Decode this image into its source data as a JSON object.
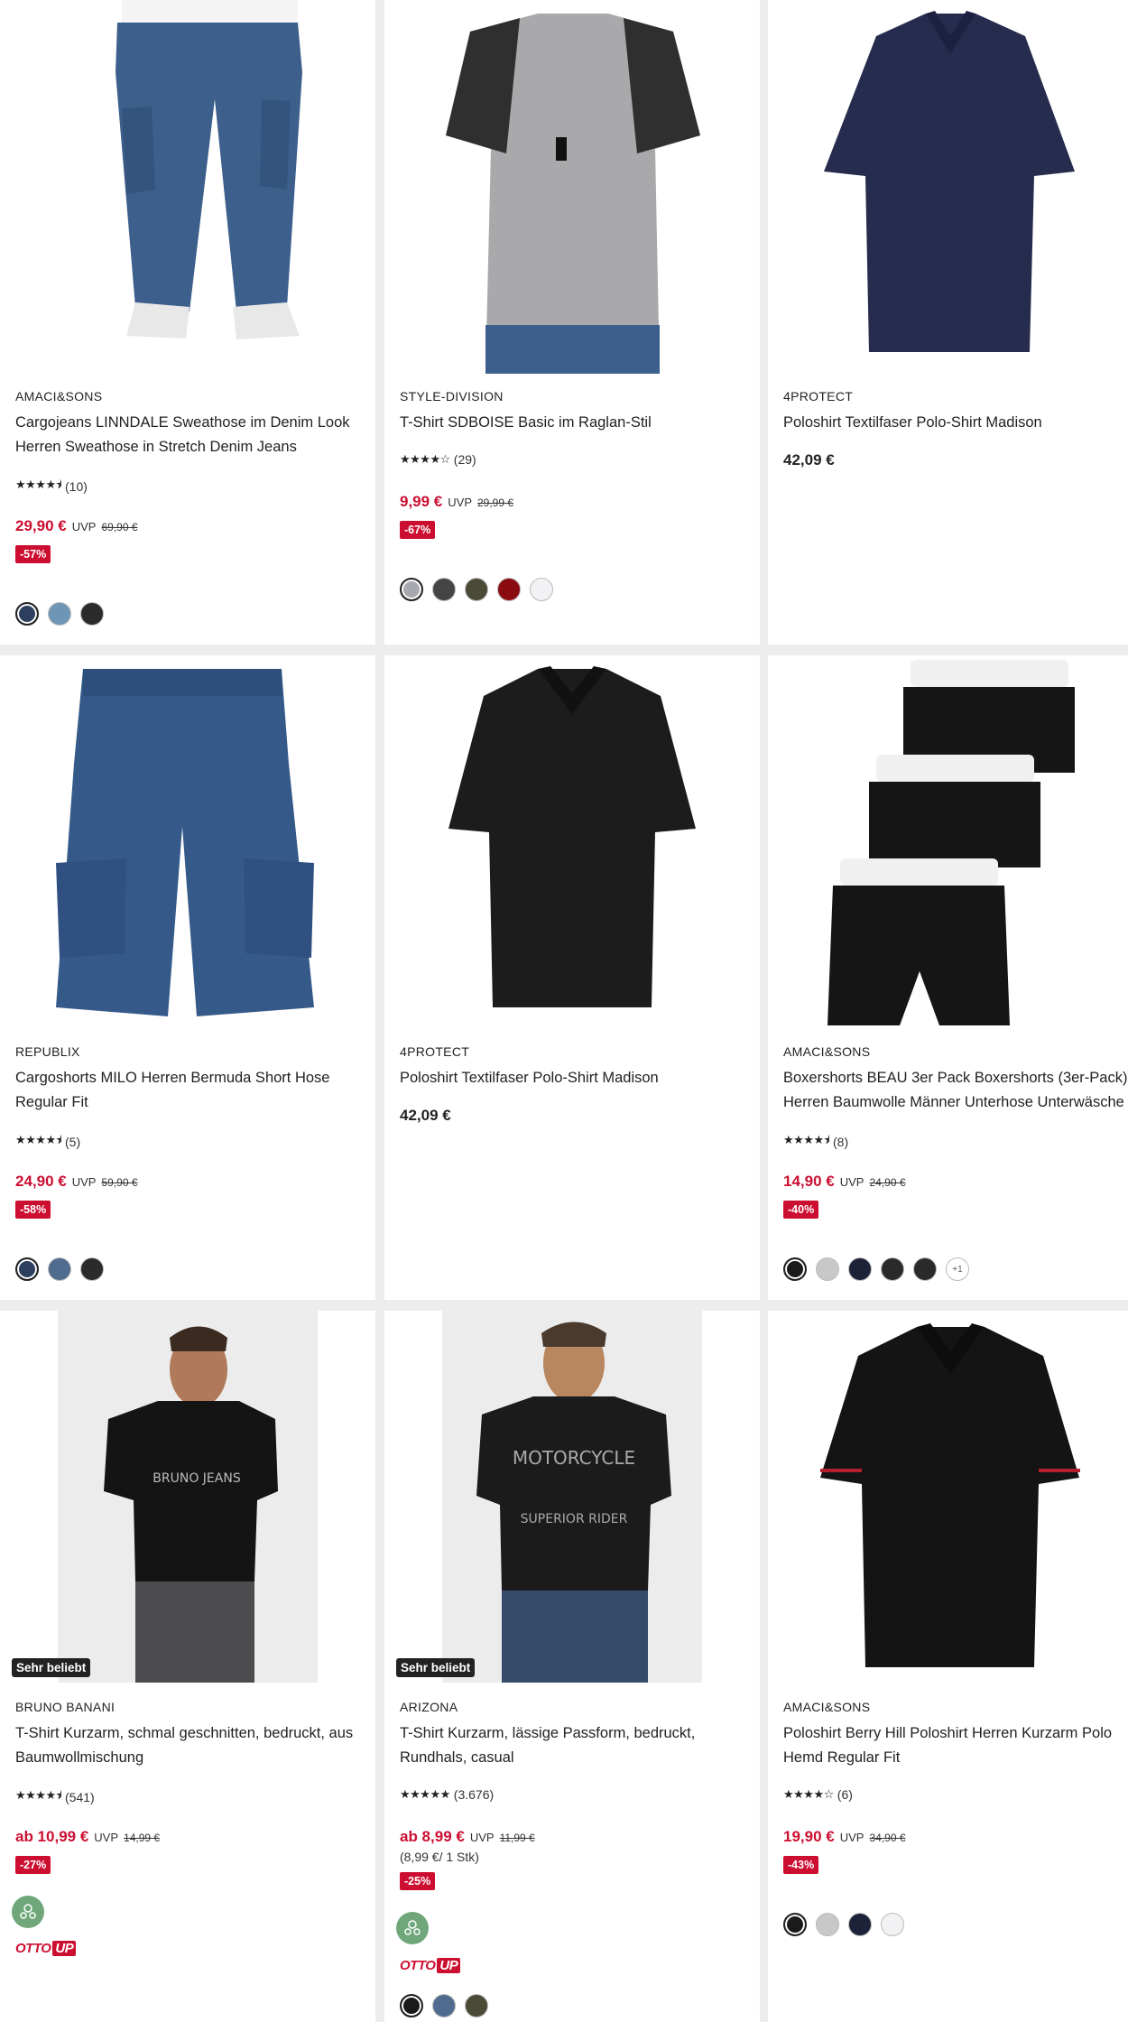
{
  "products": [
    {
      "brand": "AMACI&SONS",
      "title": "Cargojeans LINNDALE Sweathose im Denim Look Herren Sweathose in Stretch Denim Jeans",
      "rating": {
        "stars": "★★★★⯨",
        "count": "(10)"
      },
      "price": "29,90 €",
      "uvp_label": "UVP",
      "uvp": "69,90 €",
      "discount": "-57%",
      "swatches": [
        "#2c3f5e",
        "#6d96b6",
        "#2b2b2b"
      ]
    },
    {
      "brand": "STYLE-DIVISION",
      "title": "T-Shirt SDBOISE Basic im Raglan-Stil",
      "rating": {
        "stars": "★★★★☆",
        "count": "(29)"
      },
      "price": "9,99 €",
      "uvp_label": "UVP",
      "uvp": "29,99 €",
      "discount": "-67%",
      "swatches": [
        "#a8a8b0",
        "#444444",
        "#4a4a36",
        "#8a0c10",
        "#f2f2f5"
      ]
    },
    {
      "brand": "4PROTECT",
      "title": "Poloshirt Textilfaser Polo-Shirt Madison",
      "price": "42,09 €"
    },
    {
      "brand": "REPUBLIX",
      "title": "Cargoshorts MILO Herren Bermuda Short Hose Regular Fit",
      "rating": {
        "stars": "★★★★⯨",
        "count": "(5)"
      },
      "price": "24,90 €",
      "uvp_label": "UVP",
      "uvp": "59,90 €",
      "discount": "-58%",
      "swatches": [
        "#2c3f5e",
        "#4f6b8e",
        "#2b2b2b"
      ]
    },
    {
      "brand": "4PROTECT",
      "title": "Poloshirt Textilfaser Polo-Shirt Madison",
      "price": "42,09 €"
    },
    {
      "brand": "AMACI&SONS",
      "title": "Boxershorts BEAU 3er Pack Boxershorts (3er-Pack) Herren Baumwolle Männer Unterhose Unterwäsche",
      "rating": {
        "stars": "★★★★⯨",
        "count": "(8)"
      },
      "price": "14,90 €",
      "uvp_label": "UVP",
      "uvp": "24,90 €",
      "discount": "-40%",
      "swatches": [
        "#1a1a1a",
        "#c8c8c8",
        "#1e2238",
        "#2a2a2a",
        "#2a2a2a"
      ],
      "more": "+1"
    },
    {
      "brand": "BRUNO BANANI",
      "title": "T-Shirt Kurzarm, schmal geschnitten, bedruckt, aus Baumwollmischung",
      "rating": {
        "stars": "★★★★⯨",
        "count": "(541)"
      },
      "price": "ab 10,99 €",
      "uvp_label": "UVP",
      "uvp": "14,99 €",
      "discount": "-27%",
      "popular": "Sehr beliebt",
      "otto_up": "OTTO",
      "otto_up_tag": "UP"
    },
    {
      "brand": "ARIZONA",
      "title": "T-Shirt Kurzarm, lässige Passform, bedruckt, Rundhals, casual",
      "rating": {
        "stars": "★★★★★",
        "count": "(3.676)"
      },
      "price": "ab 8,99 €",
      "uvp_label": "UVP",
      "uvp": "11,99 €",
      "unit_price": "(8,99 €/ 1 Stk)",
      "discount": "-25%",
      "popular": "Sehr beliebt",
      "otto_up": "OTTO",
      "otto_up_tag": "UP",
      "swatches": [
        "#1a1a1a",
        "#4f6b8e",
        "#4a4a36"
      ]
    },
    {
      "brand": "AMACI&SONS",
      "title": "Poloshirt Berry Hill Poloshirt Herren Kurzarm Polo Hemd Regular Fit",
      "rating": {
        "stars": "★★★★☆",
        "count": "(6)"
      },
      "price": "19,90 €",
      "uvp_label": "UVP",
      "uvp": "34,90 €",
      "discount": "-43%",
      "swatches": [
        "#1a1a1a",
        "#c8c8c8",
        "#1e2238",
        "#f2f2f5"
      ]
    }
  ]
}
